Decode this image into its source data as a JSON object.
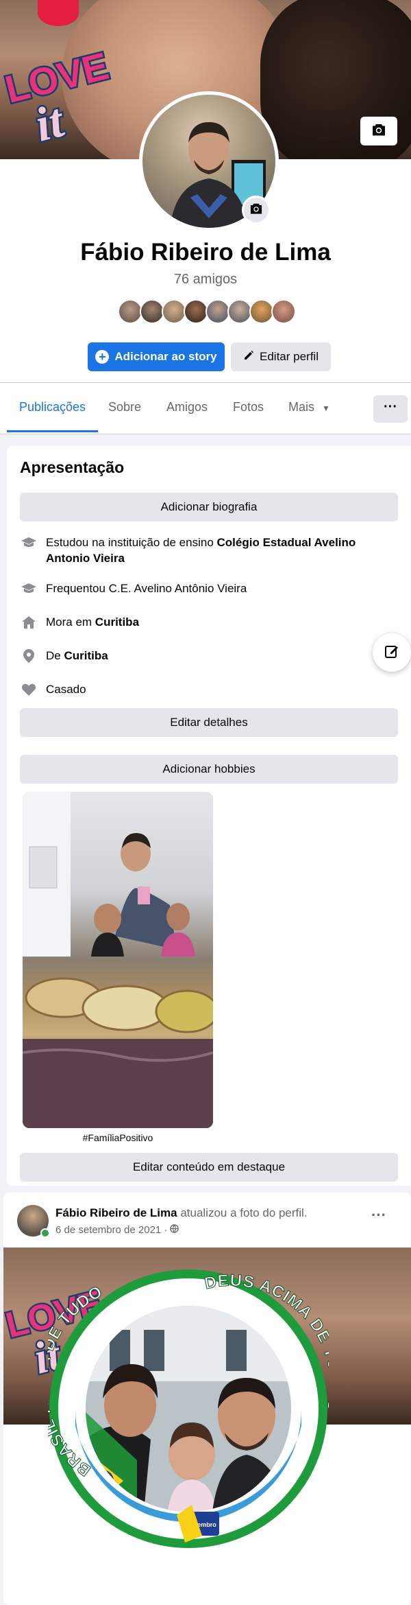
{
  "cover": {
    "sticker_text": [
      "LOVE",
      "it"
    ]
  },
  "profile": {
    "name": "Fábio Ribeiro de Lima",
    "friends_count": "76 amigos",
    "add_story_label": "Adicionar ao story",
    "edit_profile_label": "Editar perfil"
  },
  "tabs": [
    {
      "label": "Publicações",
      "active": true
    },
    {
      "label": "Sobre"
    },
    {
      "label": "Amigos"
    },
    {
      "label": "Fotos"
    },
    {
      "label": "Mais"
    }
  ],
  "tabs_more_label": "···",
  "intro": {
    "title": "Apresentação",
    "add_bio": "Adicionar biografia",
    "items": [
      {
        "icon": "graduation-cap-icon",
        "prefix": "Estudou na instituição de ensino ",
        "bold": "Colégio Estadual Avelino Antonio Vieira"
      },
      {
        "icon": "graduation-cap-icon",
        "prefix": "Frequentou C.E. Avelino Antônio Vieira",
        "bold": ""
      },
      {
        "icon": "home-icon",
        "prefix": "Mora em ",
        "bold": "Curitiba"
      },
      {
        "icon": "location-pin-icon",
        "prefix": "De ",
        "bold": "Curitiba"
      },
      {
        "icon": "heart-icon",
        "prefix": "Casado",
        "bold": ""
      }
    ],
    "edit_details": "Editar detalhes",
    "add_hobbies": "Adicionar hobbies",
    "featured_caption": "#FamíliaPositivo",
    "edit_featured": "Editar conteúdo em destaque"
  },
  "post": {
    "author": "Fábio Ribeiro de Lima",
    "action": " atualizou a foto do perfil.",
    "date": "6 de setembro de 2021 · ",
    "more": "···",
    "frame_text_left": "BRASIL ACIMA DE TUDO",
    "frame_text_right": "DEUS ACIMA DE TODOS",
    "badge_text": "Setembro"
  },
  "colors": {
    "accent": "#1b74e4",
    "page_bg": "#f0f2f5",
    "secondary_btn": "#e4e6eb",
    "muted_text": "#65676b",
    "frame_green": "#1e9b3a"
  }
}
